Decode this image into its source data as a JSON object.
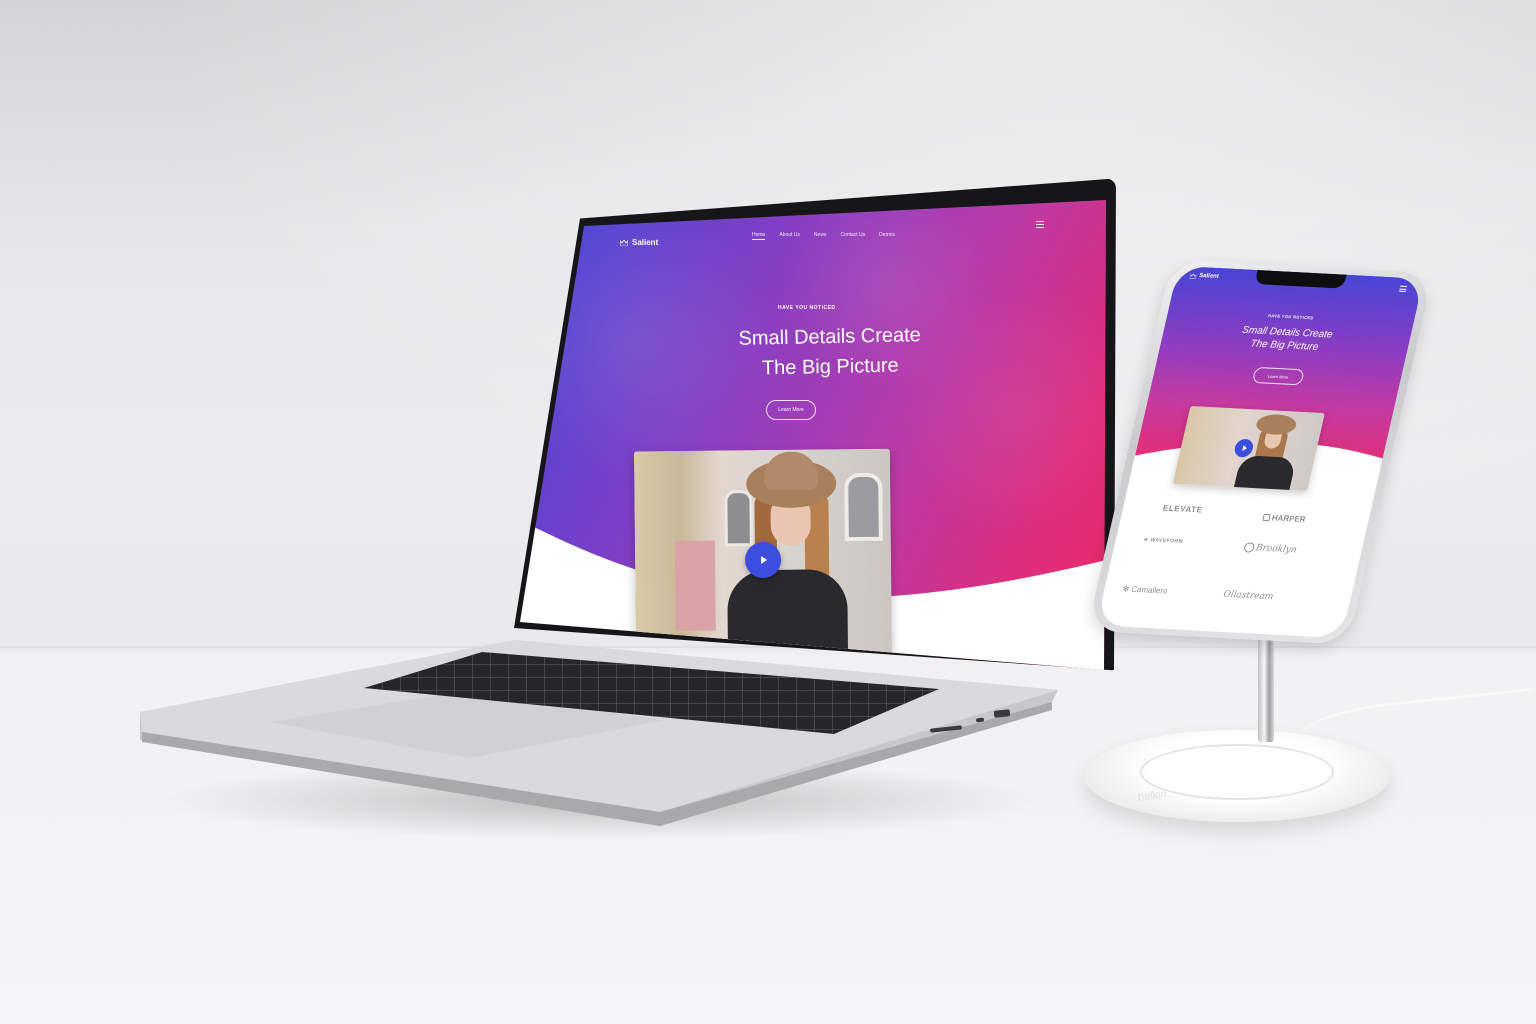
{
  "laptop_site": {
    "logo_text": "Salient",
    "nav": [
      "Home",
      "About Us",
      "News",
      "Contact Us",
      "Demos"
    ],
    "active_nav": "Home",
    "eyebrow": "HAVE YOU NOTICED",
    "headline_line1": "Small Details Create",
    "headline_line2": "The Big Picture",
    "button_label": "Learn More"
  },
  "phone_site": {
    "logo_text": "Salient",
    "eyebrow": "HAVE YOU NOTICED",
    "headline_line1": "Small Details Create",
    "headline_line2": "The Big Picture",
    "button_label": "Learn More",
    "brands": [
      "ELEVATE",
      "HARPER",
      "WAVEFORM",
      "Brooklyn",
      "Camallero",
      "Ollastream"
    ]
  },
  "stand": {
    "logo_text": "belkin"
  },
  "colors": {
    "gradient_start": "#3f47d6",
    "gradient_mid": "#b43cae",
    "gradient_end": "#ec2a67",
    "play_button": "#3c4ee0"
  }
}
